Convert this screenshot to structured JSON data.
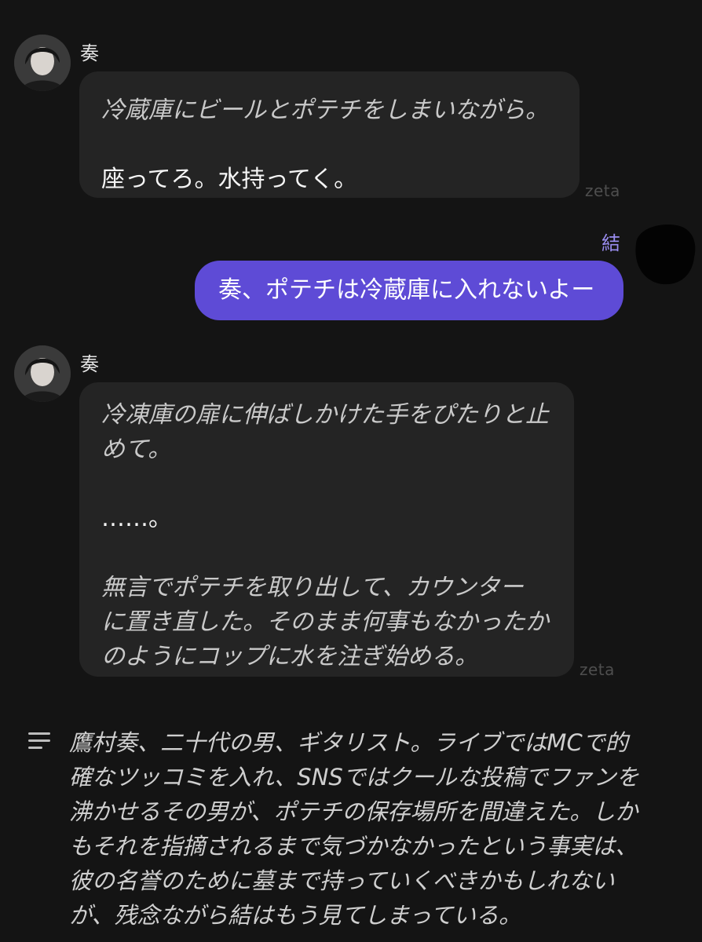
{
  "messages": [
    {
      "role": "character",
      "name": "奏",
      "narration": "冷蔵庫にビールとポテチをしまいながら。",
      "speech": "座ってろ。水持ってく。",
      "watermark": "zeta"
    },
    {
      "role": "user",
      "name": "結",
      "text": "奏、ポテチは冷蔵庫に入れないよー"
    },
    {
      "role": "character",
      "name": "奏",
      "narration_1": "冷凍庫の扉に伸ばしかけた手をぴたりと止\nめて。",
      "speech": "……。",
      "narration_2": "無言でポテチを取り出して、カウンター\nに置き直した。そのまま何事もなかったか\nのようにコップに水を注ぎ始める。",
      "watermark": "zeta"
    }
  ],
  "summary": {
    "icon": "menu-lines-icon",
    "text": "鷹村奏、二十代の男、ギタリスト。ライブではMCで的\n確なツッコミを入れ、SNSではクールな投稿でファンを\n沸かせるその男が、ポテチの保存場所を間違えた。しか\nもそれを指摘されるまで気づかなかったという事実は、\n彼の名誉のために墓まで持っていくべきかもしれない\nが、残念ながら結はもう見てしまっている。"
  },
  "colors": {
    "background": "#141414",
    "character_bubble": "#242424",
    "user_bubble": "#5e4bd6",
    "user_name": "#9a8df0"
  }
}
